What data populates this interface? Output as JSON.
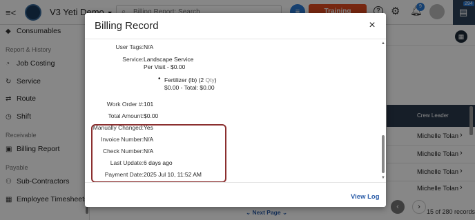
{
  "topbar": {
    "menu_icon": "menu-collapse-icon",
    "company_name": "V3 Yeti Demo",
    "search_placeholder": "Billing Report: Search",
    "training_label": "Training",
    "notifications_count": "9",
    "chat_count": "294"
  },
  "sidebar": {
    "items": [
      {
        "label": "Consumables",
        "icon": "tag-icon"
      },
      {
        "label": "Job Costing",
        "icon": "gauge-icon"
      },
      {
        "label": "Service",
        "icon": "refresh-icon"
      },
      {
        "label": "Route",
        "icon": "route-icon"
      },
      {
        "label": "Shift",
        "icon": "clock-icon"
      },
      {
        "label": "Billing Report",
        "icon": "report-icon"
      },
      {
        "label": "Sub-Contractors",
        "icon": "subcontractor-icon"
      },
      {
        "label": "Employee Timesheets",
        "icon": "timesheet-icon"
      }
    ],
    "sections": {
      "report_history": "Report & History",
      "receivable": "Receivable",
      "payable": "Payable"
    }
  },
  "background_table": {
    "header": "Crew Leader",
    "rows": [
      "Michelle Tolan",
      "Michelle Tolan",
      "Michelle Tolan",
      "Michelle Tolan"
    ],
    "next_page": "Next Page",
    "records_count": "15 of 280 records"
  },
  "modal": {
    "title": "Billing Record",
    "close_label": "×",
    "fields": {
      "user_tags": {
        "label": "User Tags:",
        "value": "N/A"
      },
      "service": {
        "label": "Service:",
        "value": "Landscape Service",
        "sub": "Per Visit - $0.00"
      },
      "item": {
        "name": "Fertilizer (lb) (",
        "qty": "2",
        "qty_unit": " Qty",
        "close": ")",
        "price": "$0.00 - Total: $0.00"
      },
      "work_order": {
        "label": "Work Order #:",
        "value": "101"
      },
      "total_amount": {
        "label": "Total Amount:",
        "value": "$0.00"
      },
      "manually_changed": {
        "label": "Manually Changed:",
        "value": "Yes"
      },
      "invoice_number": {
        "label": "Invoice Number:",
        "value": "N/A"
      },
      "check_number": {
        "label": "Check Number:",
        "value": "N/A"
      },
      "last_update": {
        "label": "Last Update:",
        "value": "6 days ago"
      },
      "payment_date": {
        "label": "Payment Date:",
        "value": "2025 Jul 10, 11:52 AM"
      }
    },
    "footer": {
      "view_log": "View Log"
    }
  },
  "colors": {
    "accent_blue": "#2a7ad4",
    "training_orange": "#e04a1f",
    "highlight_border": "#8b2f2f",
    "table_header": "#2b3a4d"
  }
}
